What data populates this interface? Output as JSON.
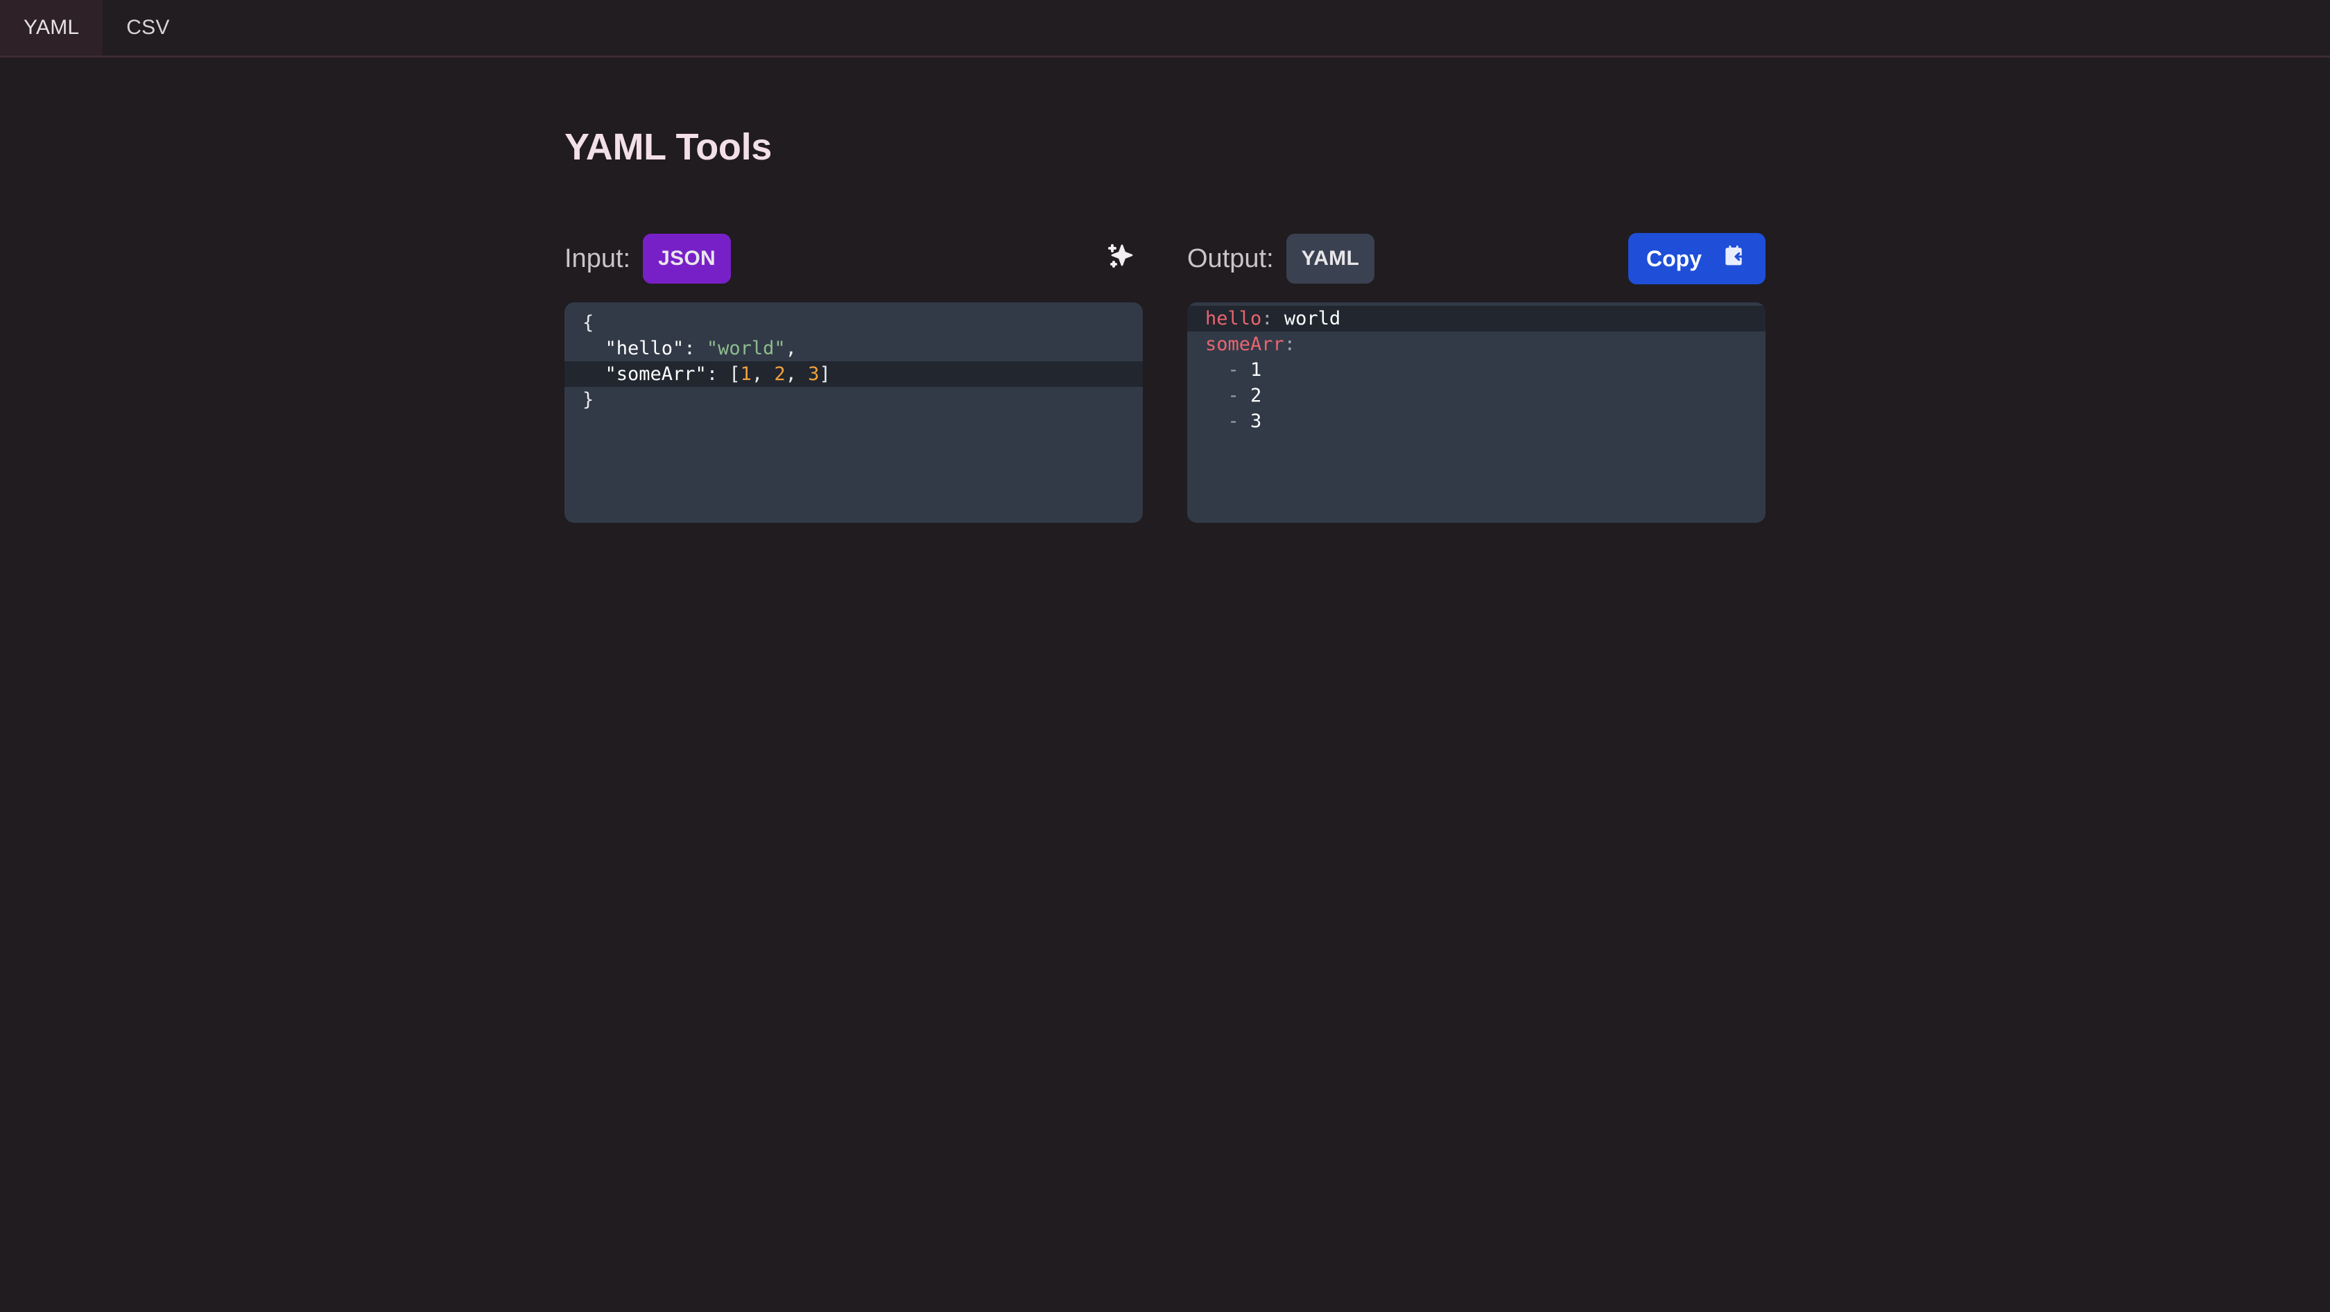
{
  "tabs": [
    {
      "label": "YAML",
      "active": true
    },
    {
      "label": "CSV",
      "active": false
    }
  ],
  "page": {
    "title": "YAML Tools"
  },
  "input": {
    "label": "Input:",
    "format": "JSON",
    "magic_icon": "sparkles-icon",
    "lines": [
      {
        "text": "{",
        "active": false
      },
      {
        "text": "  \"hello\": \"world\",",
        "active": false
      },
      {
        "text": "  \"someArr\": [1, 2, 3]",
        "active": true
      },
      {
        "text": "}",
        "active": false
      }
    ],
    "raw": "{\n  \"hello\": \"world\",\n  \"someArr\": [1, 2, 3]\n}"
  },
  "output": {
    "label": "Output:",
    "format": "YAML",
    "copy_label": "Copy",
    "copy_icon": "clipboard-paste-icon",
    "lines": [
      {
        "text": "hello: world",
        "active": true
      },
      {
        "text": "someArr:",
        "active": false
      },
      {
        "text": "  - 1",
        "active": false
      },
      {
        "text": "  - 2",
        "active": false
      },
      {
        "text": "  - 3",
        "active": false
      }
    ],
    "raw": "hello: world\nsomeArr:\n  - 1\n  - 2\n  - 3"
  },
  "colors": {
    "background": "#201c1f",
    "tab_active_bg": "#2e2128",
    "tab_border": "#3d2b33",
    "title": "#f2dfe8",
    "json_badge": "#7820c8",
    "yaml_badge": "#3a4150",
    "copy_button": "#1f4fd8",
    "editor_bg": "#323a47",
    "active_line_bg": "#22262f",
    "json_string": "#8fbc8f",
    "json_number": "#f0a33c",
    "yaml_key": "#e8666f"
  }
}
